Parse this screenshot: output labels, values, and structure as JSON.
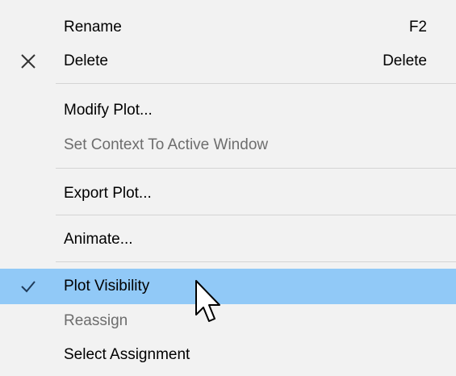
{
  "context_menu": {
    "items": [
      {
        "label": "Rename",
        "shortcut": "F2",
        "enabled": true,
        "icon": null
      },
      {
        "label": "Delete",
        "shortcut": "Delete",
        "enabled": true,
        "icon": "close-x-icon"
      },
      {
        "label": "Modify Plot...",
        "shortcut": "",
        "enabled": true,
        "icon": null
      },
      {
        "label": "Set Context To Active Window",
        "shortcut": "",
        "enabled": false,
        "icon": null
      },
      {
        "label": "Export Plot...",
        "shortcut": "",
        "enabled": true,
        "icon": null
      },
      {
        "label": "Animate...",
        "shortcut": "",
        "enabled": true,
        "icon": null
      },
      {
        "label": "Plot Visibility",
        "shortcut": "",
        "enabled": true,
        "checked": true,
        "highlighted": true,
        "icon": "checkmark-icon"
      },
      {
        "label": "Reassign",
        "shortcut": "",
        "enabled": false,
        "icon": null
      },
      {
        "label": "Select Assignment",
        "shortcut": "",
        "enabled": true,
        "icon": null
      }
    ]
  },
  "colors": {
    "menu_background": "#f2f2f2",
    "highlight": "#91c9f7",
    "disabled_text": "#6d6d6d",
    "separator": "#d4d4d4"
  }
}
